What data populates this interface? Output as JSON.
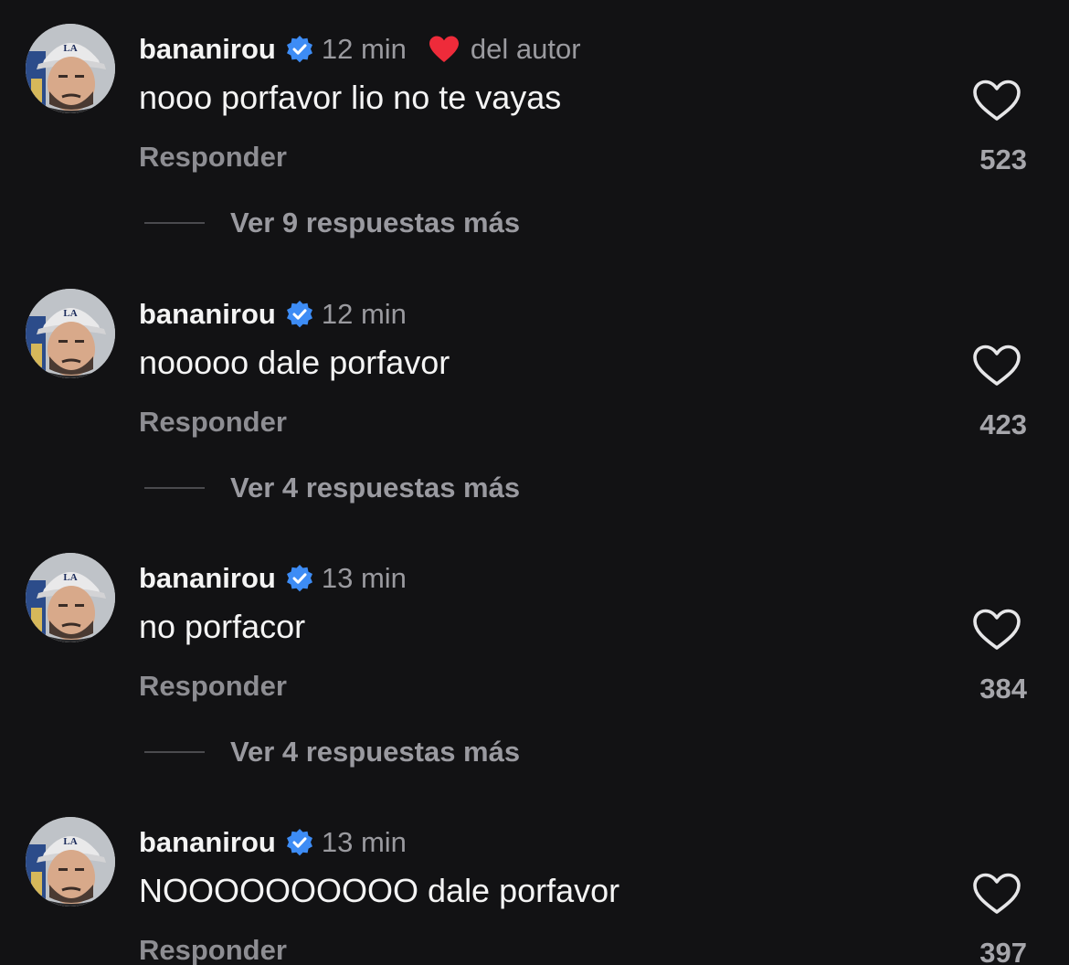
{
  "comments": [
    {
      "username": "bananirou",
      "time": "12 min",
      "author_liked": true,
      "author_label": "del autor",
      "text": "nooo porfavor lio no te vayas",
      "reply_label": "Responder",
      "likes": "523",
      "view_replies": "Ver 9 respuestas más"
    },
    {
      "username": "bananirou",
      "time": "12 min",
      "author_liked": false,
      "text": "nooooo dale porfavor",
      "reply_label": "Responder",
      "likes": "423",
      "view_replies": "Ver 4 respuestas más"
    },
    {
      "username": "bananirou",
      "time": "13 min",
      "author_liked": false,
      "text": "no porfacor",
      "reply_label": "Responder",
      "likes": "384",
      "view_replies": "Ver 4 respuestas más"
    },
    {
      "username": "bananirou",
      "time": "13 min",
      "author_liked": false,
      "text": "NOOOOOOOOOO dale porfavor",
      "reply_label": "Responder",
      "likes": "397"
    }
  ],
  "icons": {
    "verified": "verified-badge-icon",
    "author_heart": "filled-heart-icon",
    "like": "heart-outline-icon"
  },
  "colors": {
    "background": "#121214",
    "verified_blue": "#3d8cf5",
    "heart_red": "#ee2b3a"
  }
}
